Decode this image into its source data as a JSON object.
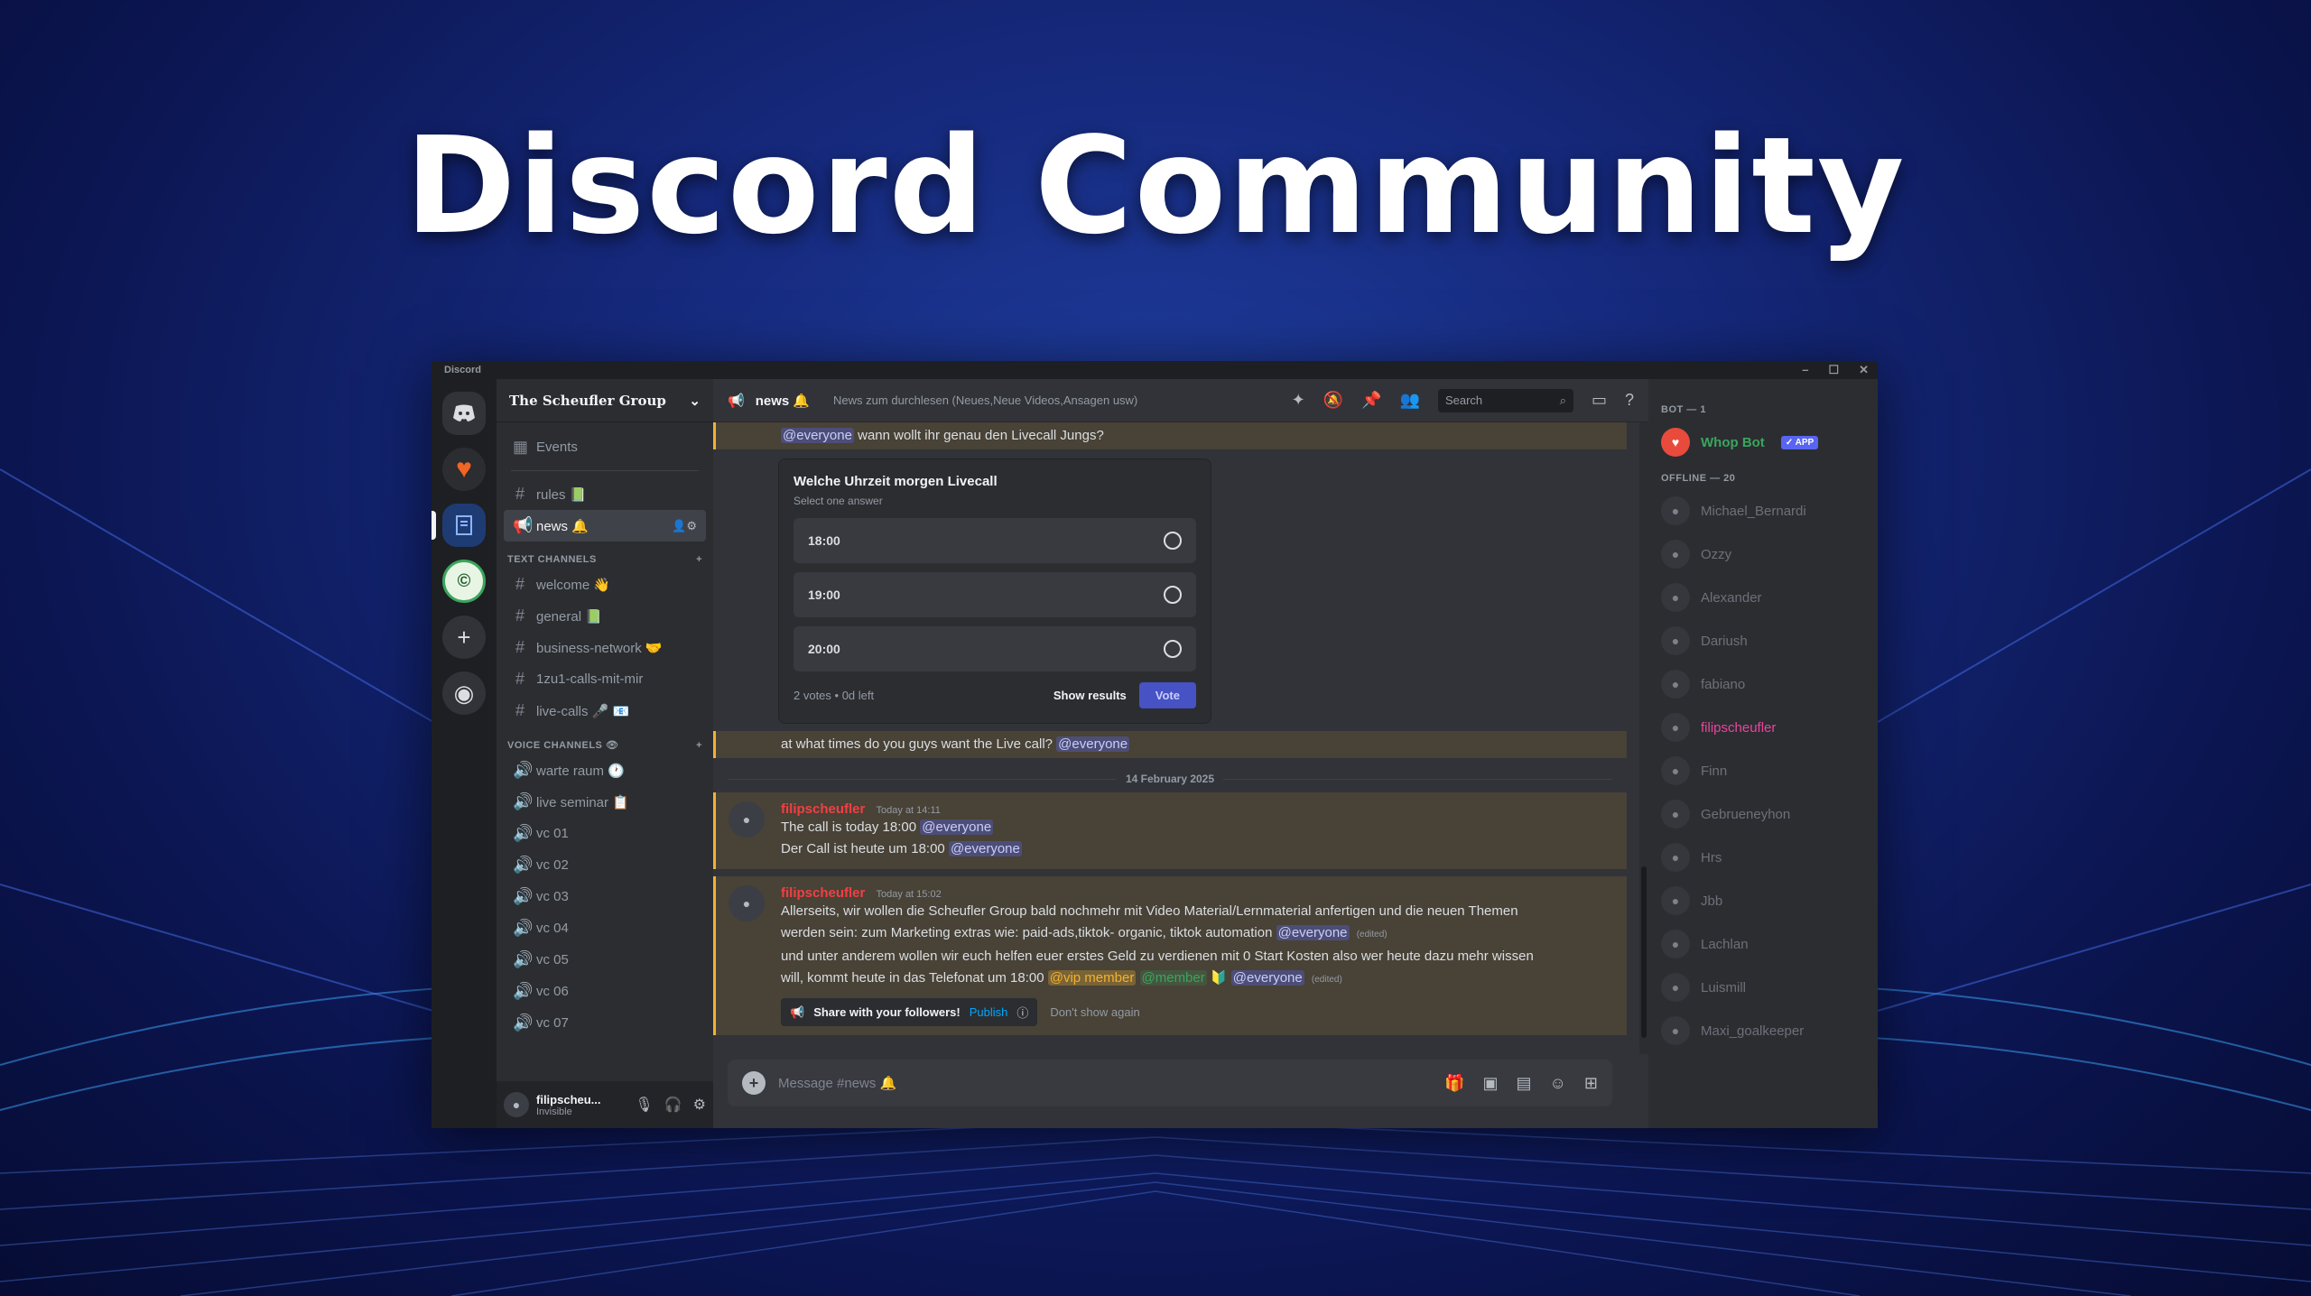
{
  "hero": {
    "title": "Discord Community"
  },
  "window": {
    "title": "Discord",
    "controls": [
      "–",
      "☐",
      "✕"
    ]
  },
  "servers": [
    "Discord home",
    "The Scheufler Group",
    "server",
    "server",
    "Add a Server",
    "Explore"
  ],
  "sidebar": {
    "server_name": "The Scheufler Group",
    "events_label": "Events",
    "top_channels": [
      {
        "name": "rules 📗",
        "type": "text"
      },
      {
        "name": "news 🔔",
        "type": "announcement",
        "selected": true
      }
    ],
    "text_category": "TEXT CHANNELS",
    "text_channels": [
      "welcome 👋",
      "general 📗",
      "business-network 🤝",
      "1zu1-calls-mit-mir",
      "live-calls 🎤 📧"
    ],
    "voice_category": "VOICE CHANNELS 👁",
    "voice_channels": [
      "warte raum 🕐",
      "live seminar 📋",
      "vc 01",
      "vc 02",
      "vc 03",
      "vc 04",
      "vc 05",
      "vc 06",
      "vc 07"
    ]
  },
  "user": {
    "name": "filipscheu...",
    "status": "Invisible"
  },
  "header": {
    "channel": "news 🔔",
    "topic": "News zum durchlesen (Neues,Neue Videos,Ansagen usw)",
    "search_placeholder": "Search"
  },
  "messages": {
    "top_line_mention": "@everyone",
    "top_line_text": "wann wollt ihr genau den Livecall Jungs?",
    "poll": {
      "question": "Welche Uhrzeit morgen Livecall",
      "subtitle": "Select one answer",
      "options": [
        "18:00",
        "19:00",
        "20:00"
      ],
      "footer": "2 votes  •  0d left",
      "show_results": "Show results",
      "vote": "Vote"
    },
    "question_text": "at what times do you guys want the Live call?",
    "question_mention": "@everyone",
    "date_divider": "14 February 2025",
    "msg1": {
      "author": "filipscheufler",
      "timestamp": "Today at 14:11",
      "line1": "The call is today 18:00",
      "line2": "Der Call ist heute um 18:00",
      "mention": "@everyone"
    },
    "msg2": {
      "author": "filipscheufler",
      "timestamp": "Today at 15:02",
      "line1": "Allerseits, wir wollen die Scheufler Group bald nochmehr mit Video Material/Lernmaterial anfertigen und die neuen Themen",
      "line2": "werden sein:  zum Marketing extras wie:   paid-ads,tiktok- organic, tiktok automation",
      "mention": "@everyone",
      "edited": "(edited)",
      "line3": "und unter anderem wollen wir euch helfen euer erstes Geld zu verdienen mit 0 Start Kosten also wer heute dazu mehr wissen",
      "line4": "will, kommt heute in das Telefonat um 18:00",
      "vip": "@vip member",
      "member": "@member",
      "publish_title": "Share with your followers!",
      "publish_action": "Publish",
      "dont_show": "Don't show again"
    }
  },
  "composer": {
    "placeholder": "Message #news 🔔"
  },
  "members": {
    "bot_category": "BOT — 1",
    "bot_name": "Whop Bot",
    "bot_tag": "✓ APP",
    "offline_category": "OFFLINE — 20",
    "offline": [
      "Michael_Bernardi",
      "Ozzy",
      "Alexander",
      "Dariush",
      "fabiano",
      "filipscheufler",
      "Finn",
      "Gebrueneyhon",
      "Hrs",
      "Jbb",
      "Lachlan",
      "Luismill",
      "Maxi_goalkeeper"
    ]
  },
  "colors": {
    "accent": "#5865f2",
    "highlight": "#f0b232",
    "author": "#f23f43",
    "online": "#3ba55d"
  }
}
